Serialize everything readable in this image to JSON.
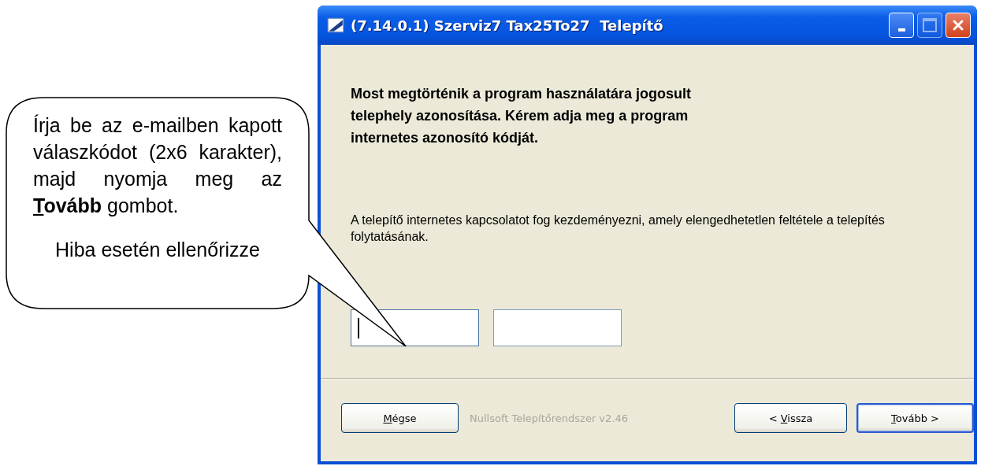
{
  "window": {
    "title": "(7.14.0.1) Szerviz7 Tax25To27  Telepítő",
    "maximize_disabled": true
  },
  "heading": "Most megtörténik a program használatára jogosult telephely azonosítása. Kérem adja meg a program internetes azonosító kódját.",
  "note": "A telepítő internetes kapcsolatot fog kezdeményezni, amely elengedhetetlen feltétele a telepítés folytatásának.",
  "fields": [
    {
      "focused": true
    },
    {
      "focused": false
    }
  ],
  "brand": "Nullsoft Telepítőrendszer v2.46",
  "buttons": [
    {
      "key": "M",
      "post": "égse",
      "default": false
    },
    {
      "pre": "< ",
      "key": "V",
      "post": "issza",
      "default": false
    },
    {
      "key": "T",
      "post": "ovább >",
      "default": true
    }
  ],
  "callout": {
    "before": "Írja be az e-mailben kapott válaszkódot (2x6 karakter), majd nyomja meg az ",
    "key": "T",
    "rest": "ovább",
    "after": " gombot.",
    "second": "Hiba esetén ellenőrizze"
  }
}
